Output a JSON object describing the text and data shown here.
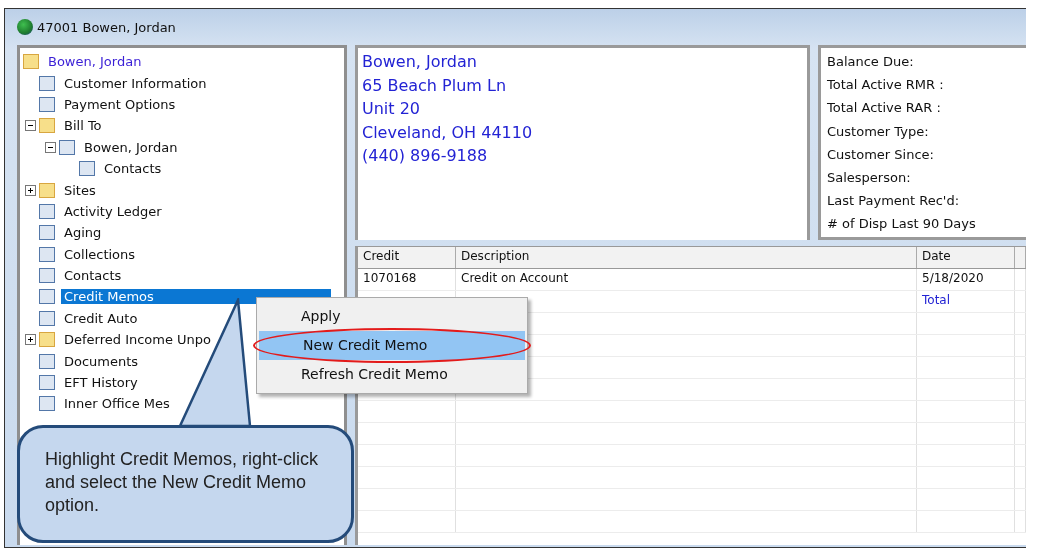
{
  "window": {
    "title": "47001  Bowen, Jordan"
  },
  "tree": {
    "label": "Bowen, Jordan",
    "kind": "folder",
    "children": [
      {
        "label": "Customer Information",
        "kind": "item",
        "selected": false
      },
      {
        "label": "Payment Options",
        "kind": "item",
        "selected": false
      },
      {
        "label": "Bill To",
        "kind": "folder",
        "expanded": true,
        "selected": false,
        "children": [
          {
            "label": "Bowen, Jordan",
            "kind": "item",
            "expanded": true,
            "selected": false,
            "children": [
              {
                "label": "Contacts",
                "kind": "item",
                "selected": false
              }
            ]
          }
        ]
      },
      {
        "label": "Sites",
        "kind": "folder",
        "expanded": false,
        "selected": false
      },
      {
        "label": "Activity Ledger",
        "kind": "item",
        "selected": false
      },
      {
        "label": "Aging",
        "kind": "item",
        "selected": false
      },
      {
        "label": "Collections",
        "kind": "item",
        "selected": false
      },
      {
        "label": "Contacts",
        "kind": "item",
        "selected": false
      },
      {
        "label": "Credit Memos",
        "kind": "item",
        "selected": true
      },
      {
        "label": "Credit Auto",
        "kind": "item",
        "selected": false
      },
      {
        "label": "Deferred Income Unpo",
        "kind": "folder",
        "expanded": false,
        "selected": false
      },
      {
        "label": "Documents",
        "kind": "item",
        "selected": false
      },
      {
        "label": "EFT History",
        "kind": "item",
        "selected": false
      },
      {
        "label": "Inner Office Mes",
        "kind": "item",
        "selected": false
      }
    ]
  },
  "address": [
    "Bowen, Jordan",
    "65 Beach Plum Ln",
    "Unit 20",
    "Cleveland, OH  44110",
    "(440) 896-9188"
  ],
  "summary": [
    "Balance Due:",
    "Total Active RMR :",
    "Total Active RAR :",
    "Customer Type:",
    "Customer Since:",
    "Salesperson:",
    "Last Payment Rec'd:",
    "# of Disp Last 90 Days"
  ],
  "table": {
    "columns": [
      "Credit",
      "Description",
      "Date"
    ],
    "rows": [
      [
        "1070168",
        "Credit on Account",
        "5/18/2020"
      ],
      [
        "",
        "",
        "Total"
      ]
    ]
  },
  "context_menu": [
    {
      "label": "Apply",
      "selected": false
    },
    {
      "label": "New Credit Memo",
      "selected": true
    },
    {
      "label": "Refresh Credit Memo",
      "selected": false
    }
  ],
  "callout": {
    "text": "Highlight Credit Memos, right-click and select the New Credit Memo option."
  }
}
